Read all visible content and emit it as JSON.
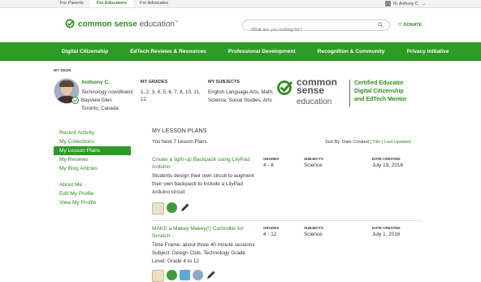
{
  "topbar": {
    "tabs": [
      "For Parents",
      "For Educators",
      "For Advocates"
    ],
    "active_tab": "For Educators",
    "user_greeting": "Hi, Anthony C."
  },
  "header": {
    "logo_bold": "common sense",
    "logo_light": "education",
    "logo_tm": "™",
    "search_placeholder": "What are you looking for?",
    "donate": "DONATE"
  },
  "nav": {
    "items": [
      "Digital Citizenship",
      "EdTech Reviews & Resources",
      "Professional Development",
      "Recognition & Community",
      "Privacy Initiative"
    ]
  },
  "profile": {
    "section_label": "MY DESK",
    "name": "Anthony C.",
    "role": "Technology coordinator",
    "location_line1": "Bayview Glen",
    "location_line2": "Toronto, Canada",
    "grades_label": "MY GRADES",
    "grades_value": "1, 2, 3, 4, 5, 6, 7, 8, 10, 11, 12",
    "subjects_label": "MY SUBJECTS",
    "subjects_value": "English Language Arts, Math, Science, Social Studies, Arts",
    "cert_logo_top": "common",
    "cert_logo_mid": "sense",
    "cert_logo_bottom": "education",
    "cert_line1": "Certified Educator",
    "cert_line2": "Digital Citizenship",
    "cert_line3": "and EdTech Mentor"
  },
  "sidebar": {
    "group1": [
      "Recent Activity",
      "My Collections",
      "My Lesson Plans",
      "My Reviews",
      "My Blog Articles"
    ],
    "group2": [
      "About Me",
      "Edit My Profile",
      "View My Profile"
    ],
    "active": "My Lesson Plans"
  },
  "lesson_plans": {
    "title": "MY LESSON PLANS",
    "count_text": "You have 7 Lesson Plans.",
    "sort_label": "Sort By:",
    "sort_date": "Date Created",
    "sort_title": "Title",
    "sort_updated": "Last Updated",
    "col_grades": "GRADES",
    "col_subjects": "SUBJECTS",
    "col_date": "DATE CREATED",
    "items": [
      {
        "title": "Create a light-up Backpack using LilyPad Arduino",
        "description": "Students design their own circuit to augment their own backpack to include a LilyPad Arduino circuit",
        "grades": "4 - 8",
        "subject": "Science",
        "date": "July 19, 2016"
      },
      {
        "title": "MAKE a Makey Makey(!) Controller for Scratch",
        "description": "Time Frame: about three 40 minute sessions Subject: Design Club, Technology Grade Level: Grade 4 to 12",
        "grades": "4 - 12",
        "subject": "Science",
        "date": "July 1, 2016"
      }
    ]
  },
  "colors": {
    "brand_green": "#2e9b26",
    "link_green": "#2e8b1e"
  }
}
